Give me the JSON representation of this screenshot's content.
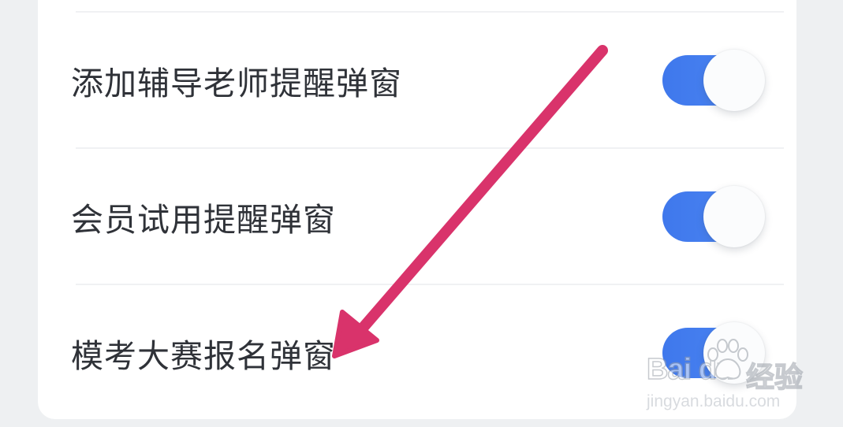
{
  "settings": {
    "items": [
      {
        "label": "添加辅导老师提醒弹窗",
        "enabled": true
      },
      {
        "label": "会员试用提醒弹窗",
        "enabled": true
      },
      {
        "label": "模考大赛报名弹窗",
        "enabled": true
      }
    ]
  },
  "watermark": {
    "logo_text": "Bai du",
    "cn_text": "经验",
    "url": "jingyan.baidu.com"
  },
  "colors": {
    "toggle_on": "#4680f0",
    "arrow": "#d9336b",
    "label_text": "#2f3238",
    "background": "#eef0f2",
    "card": "#ffffff"
  }
}
